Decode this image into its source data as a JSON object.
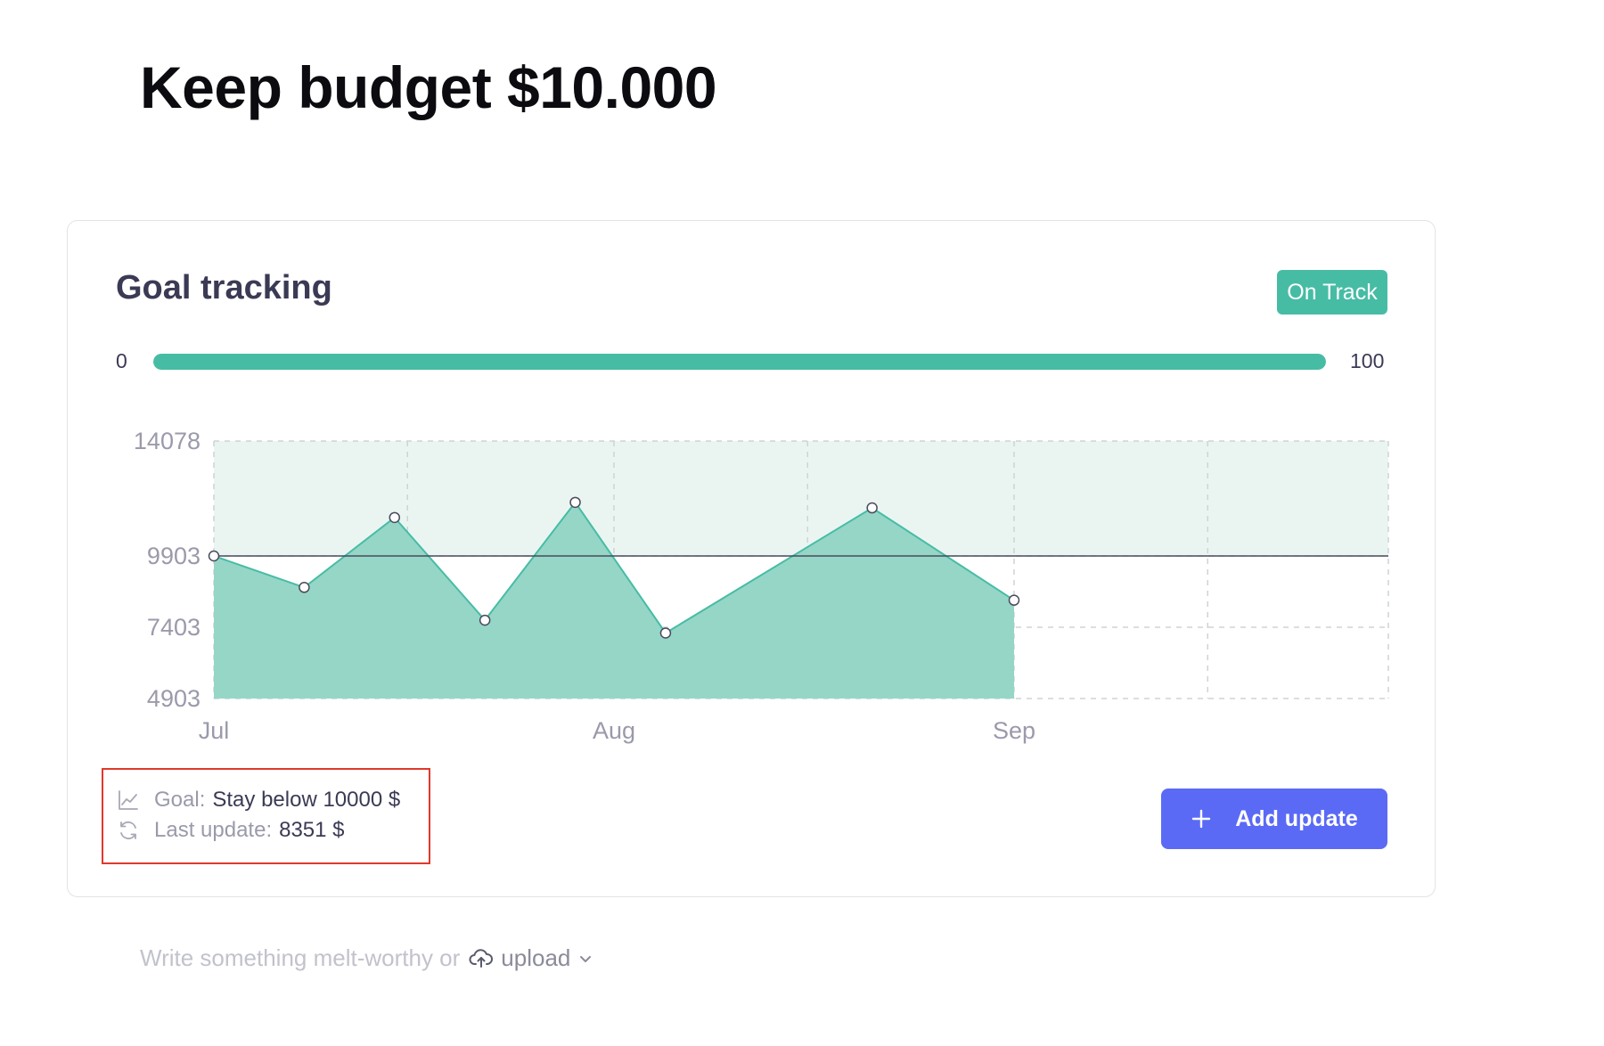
{
  "page": {
    "title": "Keep budget $10.000"
  },
  "card": {
    "title": "Goal tracking",
    "status": "On Track",
    "progress": {
      "min_label": "0",
      "max_label": "100",
      "value_fraction": 1.0
    }
  },
  "chart_data": {
    "type": "area",
    "x": [
      "2023-07-01",
      "2023-07-08",
      "2023-07-15",
      "2023-07-22",
      "2023-07-29",
      "2023-08-05",
      "2023-08-21",
      "2023-09-01"
    ],
    "series": [
      {
        "values": [
          9903,
          8800,
          11300,
          7650,
          11850,
          7200,
          11650,
          8351
        ]
      }
    ],
    "goal_line": 9903,
    "y_ticks": [
      "14078",
      "9903",
      "7403",
      "4903"
    ],
    "x_ticks": [
      "Jul",
      "Aug",
      "Sep"
    ],
    "ylim": [
      4903,
      14078
    ],
    "xlim": [
      "2023-07-01",
      "2023-09-30"
    ],
    "grid": true,
    "title": "",
    "xlabel": "",
    "ylabel": ""
  },
  "meta": {
    "goal_label": "Goal:",
    "goal_value": "Stay below 10000 $",
    "last_update_label": "Last update:",
    "last_update_value": "8351 $"
  },
  "actions": {
    "add_update_label": "Add update"
  },
  "composer": {
    "placeholder": "Write something melt-worthy or",
    "upload_label": "upload"
  },
  "colors": {
    "accent_teal": "#47bca5",
    "area_fill": "#95d6c7",
    "band_fill": "#eaf5f2",
    "primary_button": "#5b6af5",
    "highlight_border": "#e0392b",
    "title_text": "#3b3a55"
  },
  "icons": {
    "goal": "line-chart-icon",
    "last_update": "refresh-icon",
    "add": "plus-icon",
    "upload": "cloud-upload-icon",
    "dropdown": "chevron-down-icon"
  }
}
